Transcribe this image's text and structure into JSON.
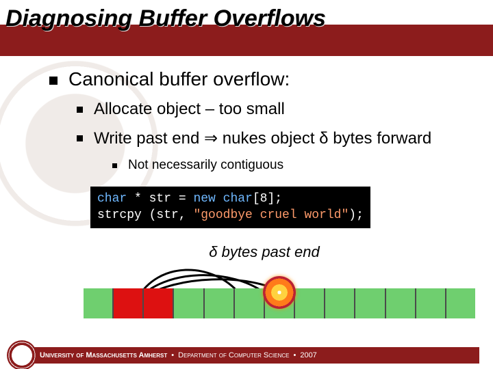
{
  "title": "Diagnosing Buffer Overflows",
  "bullets": {
    "top": "Canonical buffer overflow:",
    "sub": [
      "Allocate object – too small",
      "Write past end ⇒ nukes object δ bytes forward"
    ],
    "subsub": "Not necessarily contiguous"
  },
  "code": {
    "line1_p1": "char",
    "line1_p2": " * str = ",
    "line1_p3": "new char",
    "line1_p4": "[8];",
    "line2_p1": "strcpy (str, ",
    "line2_p2": "\"goodbye cruel world\"",
    "line2_p3": ");"
  },
  "annotation": "δ bytes past end",
  "diagram": {
    "cells": 13,
    "allocated_indices": [
      1,
      2
    ],
    "explosion_index": 6
  },
  "footer": {
    "univ": "University of Massachusetts Amherst",
    "dept": "Department of Computer Science",
    "year": "2007"
  },
  "colors": {
    "brand": "#8c1c1c",
    "alloc": "#d11",
    "free": "#6fcf6f"
  }
}
